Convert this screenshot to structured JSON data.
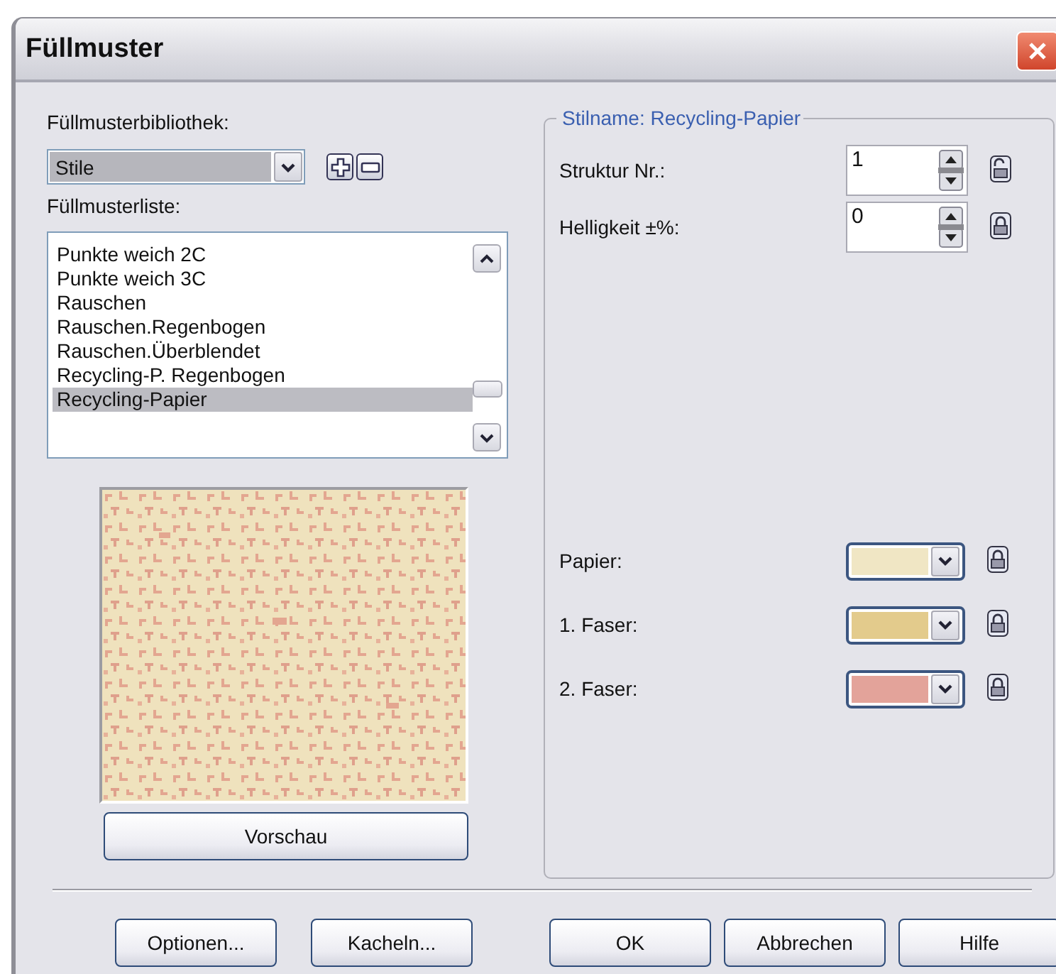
{
  "window": {
    "title": "Füllmuster"
  },
  "library": {
    "label": "Füllmusterbibliothek:",
    "value": "Stile"
  },
  "pattern_list": {
    "label": "Füllmusterliste:",
    "items": [
      {
        "text": "Punkte weich 2C",
        "selected": false
      },
      {
        "text": "Punkte weich 3C",
        "selected": false
      },
      {
        "text": "Rauschen",
        "selected": false
      },
      {
        "text": "Rauschen.Regenbogen",
        "selected": false
      },
      {
        "text": "Rauschen.Überblendet",
        "selected": false
      },
      {
        "text": "Recycling-P. Regenbogen",
        "selected": false
      },
      {
        "text": "Recycling-Papier",
        "selected": true
      }
    ]
  },
  "preview_button": "Vorschau",
  "style_group": {
    "legend": "Stilname: Recycling-Papier",
    "spin_fields": [
      {
        "label": "Struktur Nr.:",
        "value": "1",
        "locked": false
      },
      {
        "label": "Helligkeit ±%:",
        "value": "0",
        "locked": true
      }
    ],
    "color_fields": [
      {
        "label": "Papier:",
        "color": "#f0e6c4",
        "locked": true
      },
      {
        "label": "1. Faser:",
        "color": "#e3cb8c",
        "locked": true
      },
      {
        "label": "2. Faser:",
        "color": "#e3a39a",
        "locked": true
      }
    ]
  },
  "buttons": [
    {
      "label": "Optionen...",
      "kind": "left"
    },
    {
      "label": "Kacheln...",
      "kind": "left"
    },
    {
      "label": "OK",
      "kind": "right"
    },
    {
      "label": "Abbrechen",
      "kind": "right"
    },
    {
      "label": "Hilfe",
      "kind": "right"
    }
  ]
}
